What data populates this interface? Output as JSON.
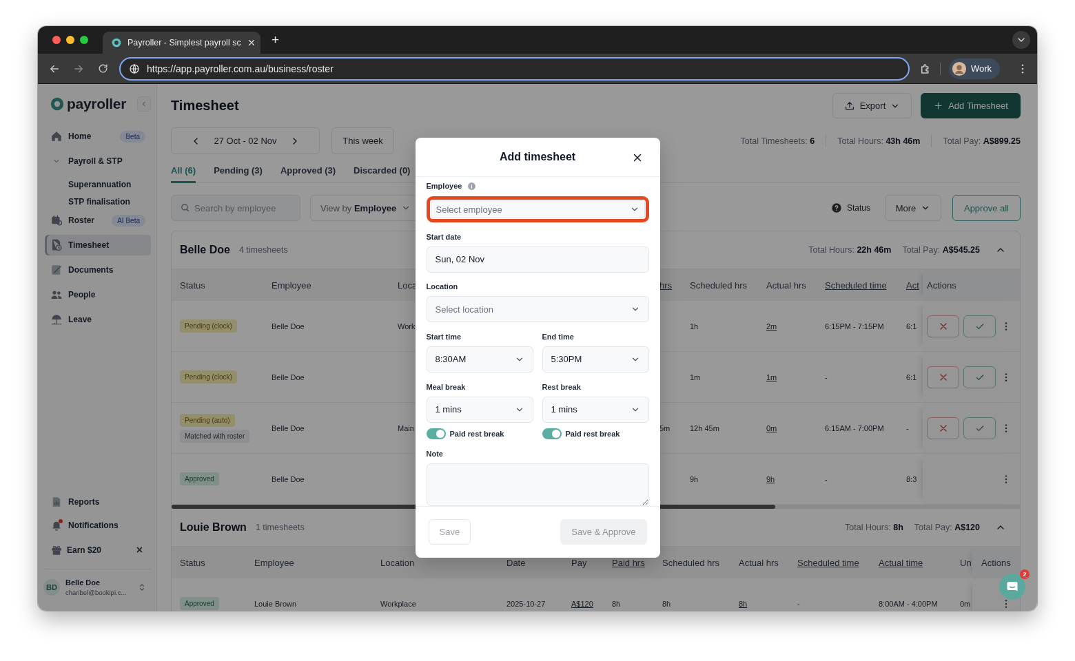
{
  "browser": {
    "tab_title": "Payroller - Simplest payroll sc",
    "new_tab": "+",
    "url": "https://app.payroller.com.au/business/roster",
    "profile": "Work"
  },
  "sidebar": {
    "logo": "payroller",
    "items": [
      {
        "label": "Home",
        "badge": "Beta",
        "selected": false
      },
      {
        "label": "Payroll & STP",
        "expanded": true,
        "selected": false,
        "children": [
          {
            "label": "Superannuation",
            "selected": false
          },
          {
            "label": "STP finalisation",
            "selected": false
          }
        ]
      },
      {
        "label": "Roster",
        "badge": "AI Beta",
        "selected": false
      },
      {
        "label": "Timesheet",
        "selected": true
      },
      {
        "label": "Documents",
        "selected": false
      },
      {
        "label": "People",
        "selected": false
      },
      {
        "label": "Leave",
        "selected": false
      }
    ],
    "bottom_items": [
      {
        "label": "Reports",
        "unread": false
      },
      {
        "label": "Notifications",
        "unread": true
      }
    ],
    "promo": {
      "label": "Earn $20",
      "close": "×"
    },
    "user": {
      "initials": "BD",
      "name": "Belle Doe",
      "email": "charibel@bookipi.c..."
    }
  },
  "page": {
    "title": "Timesheet",
    "export": "Export",
    "add": "Add Timesheet",
    "date_range": "27 Oct - 02 Nov",
    "this_week": "This week",
    "totals": [
      "Total Timesheets: **6**",
      "Total Hours: **43h 46m**",
      "Total Pay: **A$899.25**"
    ],
    "tabs": [
      {
        "label": "All (6)",
        "selected": true
      },
      {
        "label": "Pending (3)",
        "selected": false
      },
      {
        "label": "Approved (3)",
        "selected": false
      },
      {
        "label": "Discarded (0)",
        "selected": false
      }
    ],
    "search": {
      "placeholder": "Search by employee"
    },
    "view_by": "View by **Employee**",
    "status_help": "Status",
    "more": "More",
    "approve_all": "Approve all"
  },
  "groups": [
    {
      "name": "Belle Doe",
      "count": "4 timesheets",
      "totals": [
        "Total Hours: **22h 46m**",
        "Total Pay: **A$545.25**"
      ],
      "expanded": true,
      "columns": [
        {
          "label": "Status",
          "underlined": false
        },
        {
          "label": "Employee",
          "underlined": false
        },
        {
          "label": "Loca",
          "underlined": false
        },
        {
          "label": "hrs",
          "underlined": true
        },
        {
          "label": "Scheduled hrs",
          "underlined": false
        },
        {
          "label": "Actual hrs",
          "underlined": false
        },
        {
          "label": "Scheduled time",
          "underlined": true
        },
        {
          "label": "Act",
          "underlined": true
        },
        {
          "label": "Actions",
          "underlined": false
        }
      ],
      "rows": [
        {
          "status": [
            {
              "label": "Pending (clock)",
              "kind": "pending"
            }
          ],
          "employee": "Belle Doe",
          "column_3": "Work",
          "scheduled_hrs": "1h",
          "actual_hrs": "2m",
          "scheduled_time": "6:15PM - 7:15PM",
          "column_8": "6:1",
          "review": true
        },
        {
          "status": [
            {
              "label": "Pending (clock)",
              "kind": "pending"
            }
          ],
          "employee": "Belle Doe",
          "scheduled_hrs": "1m",
          "actual_hrs": "1m",
          "scheduled_time": "-",
          "column_8": "6:1",
          "review": true
        },
        {
          "status": [
            {
              "label": "Pending (auto)",
              "kind": "pending"
            },
            {
              "label": "Matched with roster",
              "kind": "matched"
            }
          ],
          "employee": "Belle Doe",
          "column_3": "Main",
          "column_4": "5m",
          "scheduled_hrs": "12h 45m",
          "actual_hrs": "0m",
          "scheduled_time": "6:15AM - 7:00PM",
          "column_8": "-",
          "review": true
        },
        {
          "status": [
            {
              "label": "Approved",
              "kind": "approved"
            }
          ],
          "employee": "Belle Doe",
          "scheduled_hrs": "9h",
          "actual_hrs": "9h",
          "scheduled_time": "-",
          "column_8": "8:3",
          "review": false
        }
      ]
    },
    {
      "name": "Louie Brown",
      "count": "1 timesheets",
      "totals": [
        "Total Hours: **8h**",
        "Total Pay: **A$120**"
      ],
      "expanded": true,
      "columns": [
        {
          "label": "Status",
          "underlined": false
        },
        {
          "label": "Employee",
          "underlined": false
        },
        {
          "label": "Location",
          "underlined": false
        },
        {
          "label": "Date",
          "underlined": false
        },
        {
          "label": "Pay",
          "underlined": false
        },
        {
          "label": "Paid hrs",
          "underlined": true
        },
        {
          "label": "Scheduled hrs",
          "underlined": false
        },
        {
          "label": "Actual hrs",
          "underlined": false
        },
        {
          "label": "Scheduled time",
          "underlined": true
        },
        {
          "label": "Actual time",
          "underlined": true
        },
        {
          "label": "Un",
          "underlined": false
        },
        {
          "label": "Actions",
          "underlined": false
        }
      ],
      "rows": [
        {
          "status": [
            {
              "label": "Approved",
              "kind": "approved"
            }
          ],
          "employee": "Louie Brown",
          "location": "Workplace",
          "date": "2025-10-27",
          "pay": "A$120",
          "paid_hrs": "8h",
          "scheduled_hrs": "8h",
          "actual_hrs": "8h",
          "scheduled_time": "-",
          "actual_time": "8:00AM - 4:00PM",
          "column_11": "0m",
          "review": false
        }
      ]
    }
  ],
  "modal": {
    "title": "Add timesheet",
    "employee": {
      "label": "Employee",
      "placeholder": "Select employee",
      "highlighted": true
    },
    "start_date": {
      "label": "Start date",
      "value": "Sun, 02 Nov"
    },
    "location": {
      "label": "Location",
      "placeholder": "Select location"
    },
    "start_time": {
      "label": "Start time",
      "value": "8:30AM"
    },
    "end_time": {
      "label": "End time",
      "value": "5:30PM"
    },
    "meal_break": {
      "label": "Meal break",
      "value": "1 mins",
      "toggle": {
        "label": "Paid rest break",
        "on": true
      }
    },
    "rest_break": {
      "label": "Rest break",
      "value": "1 mins",
      "toggle": {
        "label": "Paid rest break",
        "on": true
      }
    },
    "note": {
      "label": "Note"
    },
    "buttons": [
      {
        "label": "Save",
        "disabled": true
      },
      {
        "label": "Save & Approve",
        "disabled": true
      }
    ]
  },
  "chat": {
    "badge": "2"
  }
}
